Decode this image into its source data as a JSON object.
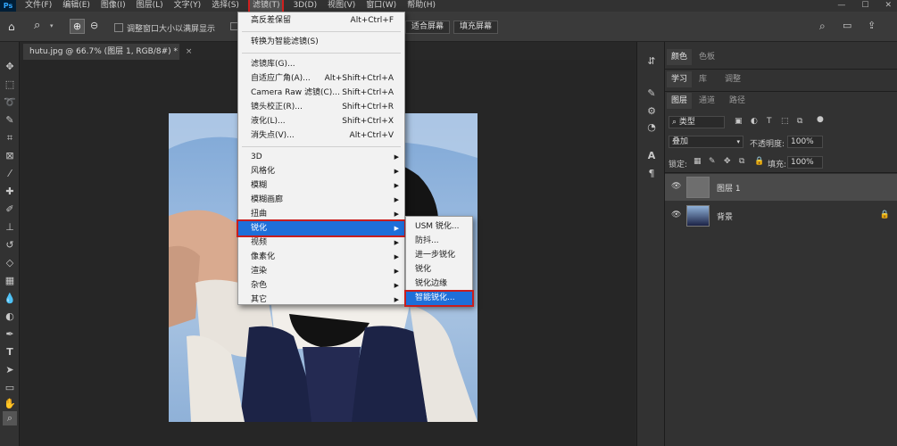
{
  "app": {
    "logo": "Ps"
  },
  "menubar": {
    "items": [
      "文件(F)",
      "编辑(E)",
      "图像(I)",
      "图层(L)",
      "文字(Y)",
      "选择(S)",
      "滤镜(T)",
      "3D(D)",
      "视图(V)",
      "窗口(W)",
      "帮助(H)"
    ],
    "active_index": 6
  },
  "options": {
    "resize_window_label": "调整窗口大小以满屏显示",
    "fit_screen_label": "适合屏幕",
    "fill_screen_label": "填充屏幕"
  },
  "document": {
    "tab_title": "hutu.jpg @ 66.7% (图层 1, RGB/8#) *",
    "close_glyph": "×"
  },
  "filter_menu": {
    "top_items": [
      {
        "label": "高反差保留",
        "shortcut": "Alt+Ctrl+F"
      },
      {
        "label": "转换为智能滤镜(S)",
        "shortcut": ""
      }
    ],
    "mid_items": [
      {
        "label": "滤镜库(G)...",
        "shortcut": ""
      },
      {
        "label": "自适应广角(A)...",
        "shortcut": "Alt+Shift+Ctrl+A"
      },
      {
        "label": "Camera Raw 滤镜(C)...",
        "shortcut": "Shift+Ctrl+A"
      },
      {
        "label": "镜头校正(R)...",
        "shortcut": "Shift+Ctrl+R"
      },
      {
        "label": "液化(L)...",
        "shortcut": "Shift+Ctrl+X"
      },
      {
        "label": "消失点(V)...",
        "shortcut": "Alt+Ctrl+V"
      }
    ],
    "sub_items": [
      "3D",
      "风格化",
      "模糊",
      "模糊画廊",
      "扭曲",
      "锐化",
      "视频",
      "像素化",
      "渲染",
      "杂色",
      "其它"
    ],
    "highlighted_sub": "锐化"
  },
  "sharpen_submenu": {
    "items": [
      "USM 锐化...",
      "防抖...",
      "进一步锐化",
      "锐化",
      "锐化边缘",
      "智能锐化..."
    ],
    "highlighted": "智能锐化..."
  },
  "panels": {
    "top_tabs": [
      "颜色",
      "色板"
    ],
    "mid_tabs": [
      "学习",
      "库",
      "调整"
    ],
    "layer_tabs": [
      "图层",
      "通道",
      "路径"
    ],
    "kind_label": "类型",
    "blend_mode": "叠加",
    "opacity_label": "不透明度:",
    "opacity_value": "100%",
    "lock_label": "锁定:",
    "fill_label": "填充:",
    "fill_value": "100%",
    "layers": [
      {
        "name": "图层 1",
        "selected": true,
        "locked": false
      },
      {
        "name": "背景",
        "selected": false,
        "locked": true
      }
    ]
  },
  "colors": {
    "highlight": "#1e6fd9",
    "annotation_red": "#c81e1e",
    "canvas_bg": "#262626"
  }
}
